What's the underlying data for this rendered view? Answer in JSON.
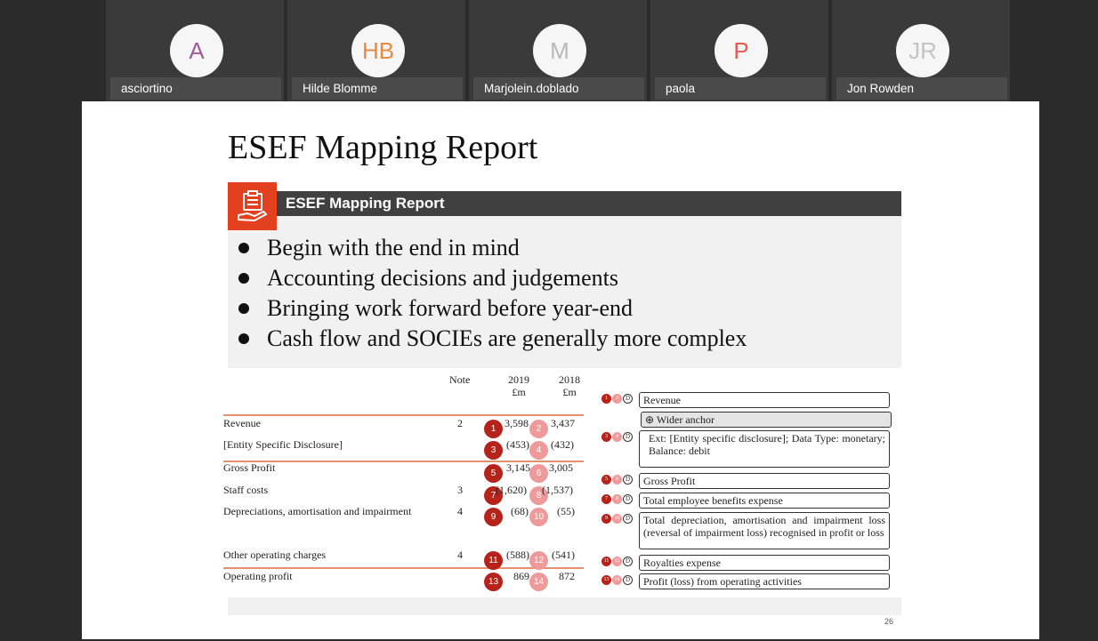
{
  "participants": [
    {
      "initials": "A",
      "name": "asciortino",
      "color": "#a05c9b"
    },
    {
      "initials": "HB",
      "name": "Hilde Blomme",
      "color": "#e58a3f"
    },
    {
      "initials": "M",
      "name": "Marjolein.doblado",
      "color": "#b9b9b9"
    },
    {
      "initials": "P",
      "name": "paola",
      "color": "#e55b4c"
    },
    {
      "initials": "JR",
      "name": "Jon Rowden",
      "color": "#c3c3c3"
    }
  ],
  "slide": {
    "title": "ESEF Mapping Report",
    "banner": "ESEF Mapping Report",
    "banner_icon": "clipboard-hand-icon",
    "accent_color": "#e2401e",
    "bullets": [
      "Begin with the end in mind",
      "Accounting decisions and judgements",
      "Bringing work forward before year-end",
      "Cash flow and SOCIEs are generally more complex"
    ],
    "page_number": "26",
    "table": {
      "headers": {
        "note": "Note",
        "y2019": "2019",
        "y2019_unit": "£m",
        "y2018": "2018",
        "y2018_unit": "£m"
      },
      "rows": [
        {
          "label": "Revenue",
          "note": "2",
          "b1": "1",
          "v2019": "3,598",
          "b2": "2",
          "v2018": "3,437"
        },
        {
          "label": "[Entity Specific Disclosure]",
          "note": "",
          "b1": "3",
          "v2019": "(453)",
          "b2": "4",
          "v2018": "(432)"
        },
        {
          "label": "Gross Profit",
          "note": "",
          "b1": "5",
          "v2019": "3,145",
          "b2": "6",
          "v2018": "3,005"
        },
        {
          "label": "Staff costs",
          "note": "3",
          "b1": "7",
          "v2019": "(1,620)",
          "b2": "8",
          "v2018": "(1,537)"
        },
        {
          "label": "Depreciations, amortisation and impairment",
          "note": "4",
          "b1": "9",
          "v2019": "(68)",
          "b2": "10",
          "v2018": "(55)"
        },
        {
          "label": "Other operating charges",
          "note": "4",
          "b1": "11",
          "v2019": "(588)",
          "b2": "12",
          "v2018": "(541)"
        },
        {
          "label": "Operating profit",
          "note": "",
          "b1": "13",
          "v2019": "869",
          "b2": "14",
          "v2018": "872"
        }
      ]
    },
    "tags": [
      {
        "text": "Revenue",
        "badges": [
          "1",
          "2"
        ]
      },
      {
        "text": "Wider anchor",
        "badges": []
      },
      {
        "text": "Ext: [Entity specific disclosure]; Data Type: monetary; Balance: debit",
        "badges": [
          "3",
          "4"
        ]
      },
      {
        "text": "Gross Profit",
        "badges": [
          "5",
          "6"
        ]
      },
      {
        "text": "Total employee benefits expense",
        "badges": [
          "7",
          "8"
        ]
      },
      {
        "text": "Total depreciation, amortisation and impairment loss (reversal of impairment loss) recognised in profit or loss",
        "badges": [
          "9",
          "10"
        ]
      },
      {
        "text": "Royalties expense",
        "badges": [
          "11",
          "12"
        ]
      },
      {
        "text": "Profit (loss) from operating activities",
        "badges": [
          "13",
          "14"
        ]
      }
    ],
    "dimension_marker": "D"
  }
}
